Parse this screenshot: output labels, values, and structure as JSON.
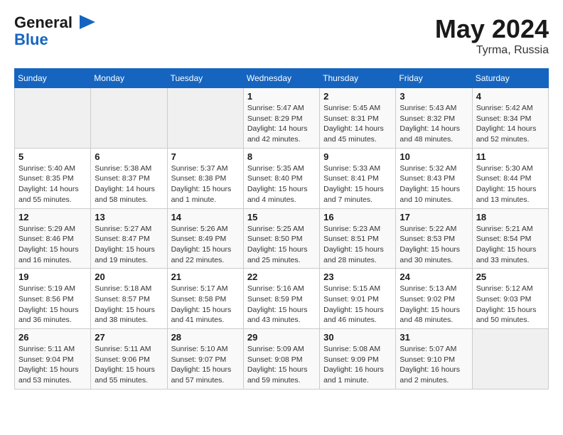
{
  "header": {
    "logo_line1": "General",
    "logo_line2": "Blue",
    "title": "May 2024",
    "subtitle": "Tyrma, Russia"
  },
  "days_of_week": [
    "Sunday",
    "Monday",
    "Tuesday",
    "Wednesday",
    "Thursday",
    "Friday",
    "Saturday"
  ],
  "weeks": [
    [
      {
        "num": "",
        "info": ""
      },
      {
        "num": "",
        "info": ""
      },
      {
        "num": "",
        "info": ""
      },
      {
        "num": "1",
        "info": "Sunrise: 5:47 AM\nSunset: 8:29 PM\nDaylight: 14 hours\nand 42 minutes."
      },
      {
        "num": "2",
        "info": "Sunrise: 5:45 AM\nSunset: 8:31 PM\nDaylight: 14 hours\nand 45 minutes."
      },
      {
        "num": "3",
        "info": "Sunrise: 5:43 AM\nSunset: 8:32 PM\nDaylight: 14 hours\nand 48 minutes."
      },
      {
        "num": "4",
        "info": "Sunrise: 5:42 AM\nSunset: 8:34 PM\nDaylight: 14 hours\nand 52 minutes."
      }
    ],
    [
      {
        "num": "5",
        "info": "Sunrise: 5:40 AM\nSunset: 8:35 PM\nDaylight: 14 hours\nand 55 minutes."
      },
      {
        "num": "6",
        "info": "Sunrise: 5:38 AM\nSunset: 8:37 PM\nDaylight: 14 hours\nand 58 minutes."
      },
      {
        "num": "7",
        "info": "Sunrise: 5:37 AM\nSunset: 8:38 PM\nDaylight: 15 hours\nand 1 minute."
      },
      {
        "num": "8",
        "info": "Sunrise: 5:35 AM\nSunset: 8:40 PM\nDaylight: 15 hours\nand 4 minutes."
      },
      {
        "num": "9",
        "info": "Sunrise: 5:33 AM\nSunset: 8:41 PM\nDaylight: 15 hours\nand 7 minutes."
      },
      {
        "num": "10",
        "info": "Sunrise: 5:32 AM\nSunset: 8:43 PM\nDaylight: 15 hours\nand 10 minutes."
      },
      {
        "num": "11",
        "info": "Sunrise: 5:30 AM\nSunset: 8:44 PM\nDaylight: 15 hours\nand 13 minutes."
      }
    ],
    [
      {
        "num": "12",
        "info": "Sunrise: 5:29 AM\nSunset: 8:46 PM\nDaylight: 15 hours\nand 16 minutes."
      },
      {
        "num": "13",
        "info": "Sunrise: 5:27 AM\nSunset: 8:47 PM\nDaylight: 15 hours\nand 19 minutes."
      },
      {
        "num": "14",
        "info": "Sunrise: 5:26 AM\nSunset: 8:49 PM\nDaylight: 15 hours\nand 22 minutes."
      },
      {
        "num": "15",
        "info": "Sunrise: 5:25 AM\nSunset: 8:50 PM\nDaylight: 15 hours\nand 25 minutes."
      },
      {
        "num": "16",
        "info": "Sunrise: 5:23 AM\nSunset: 8:51 PM\nDaylight: 15 hours\nand 28 minutes."
      },
      {
        "num": "17",
        "info": "Sunrise: 5:22 AM\nSunset: 8:53 PM\nDaylight: 15 hours\nand 30 minutes."
      },
      {
        "num": "18",
        "info": "Sunrise: 5:21 AM\nSunset: 8:54 PM\nDaylight: 15 hours\nand 33 minutes."
      }
    ],
    [
      {
        "num": "19",
        "info": "Sunrise: 5:19 AM\nSunset: 8:56 PM\nDaylight: 15 hours\nand 36 minutes."
      },
      {
        "num": "20",
        "info": "Sunrise: 5:18 AM\nSunset: 8:57 PM\nDaylight: 15 hours\nand 38 minutes."
      },
      {
        "num": "21",
        "info": "Sunrise: 5:17 AM\nSunset: 8:58 PM\nDaylight: 15 hours\nand 41 minutes."
      },
      {
        "num": "22",
        "info": "Sunrise: 5:16 AM\nSunset: 8:59 PM\nDaylight: 15 hours\nand 43 minutes."
      },
      {
        "num": "23",
        "info": "Sunrise: 5:15 AM\nSunset: 9:01 PM\nDaylight: 15 hours\nand 46 minutes."
      },
      {
        "num": "24",
        "info": "Sunrise: 5:13 AM\nSunset: 9:02 PM\nDaylight: 15 hours\nand 48 minutes."
      },
      {
        "num": "25",
        "info": "Sunrise: 5:12 AM\nSunset: 9:03 PM\nDaylight: 15 hours\nand 50 minutes."
      }
    ],
    [
      {
        "num": "26",
        "info": "Sunrise: 5:11 AM\nSunset: 9:04 PM\nDaylight: 15 hours\nand 53 minutes."
      },
      {
        "num": "27",
        "info": "Sunrise: 5:11 AM\nSunset: 9:06 PM\nDaylight: 15 hours\nand 55 minutes."
      },
      {
        "num": "28",
        "info": "Sunrise: 5:10 AM\nSunset: 9:07 PM\nDaylight: 15 hours\nand 57 minutes."
      },
      {
        "num": "29",
        "info": "Sunrise: 5:09 AM\nSunset: 9:08 PM\nDaylight: 15 hours\nand 59 minutes."
      },
      {
        "num": "30",
        "info": "Sunrise: 5:08 AM\nSunset: 9:09 PM\nDaylight: 16 hours\nand 1 minute."
      },
      {
        "num": "31",
        "info": "Sunrise: 5:07 AM\nSunset: 9:10 PM\nDaylight: 16 hours\nand 2 minutes."
      },
      {
        "num": "",
        "info": ""
      }
    ]
  ]
}
